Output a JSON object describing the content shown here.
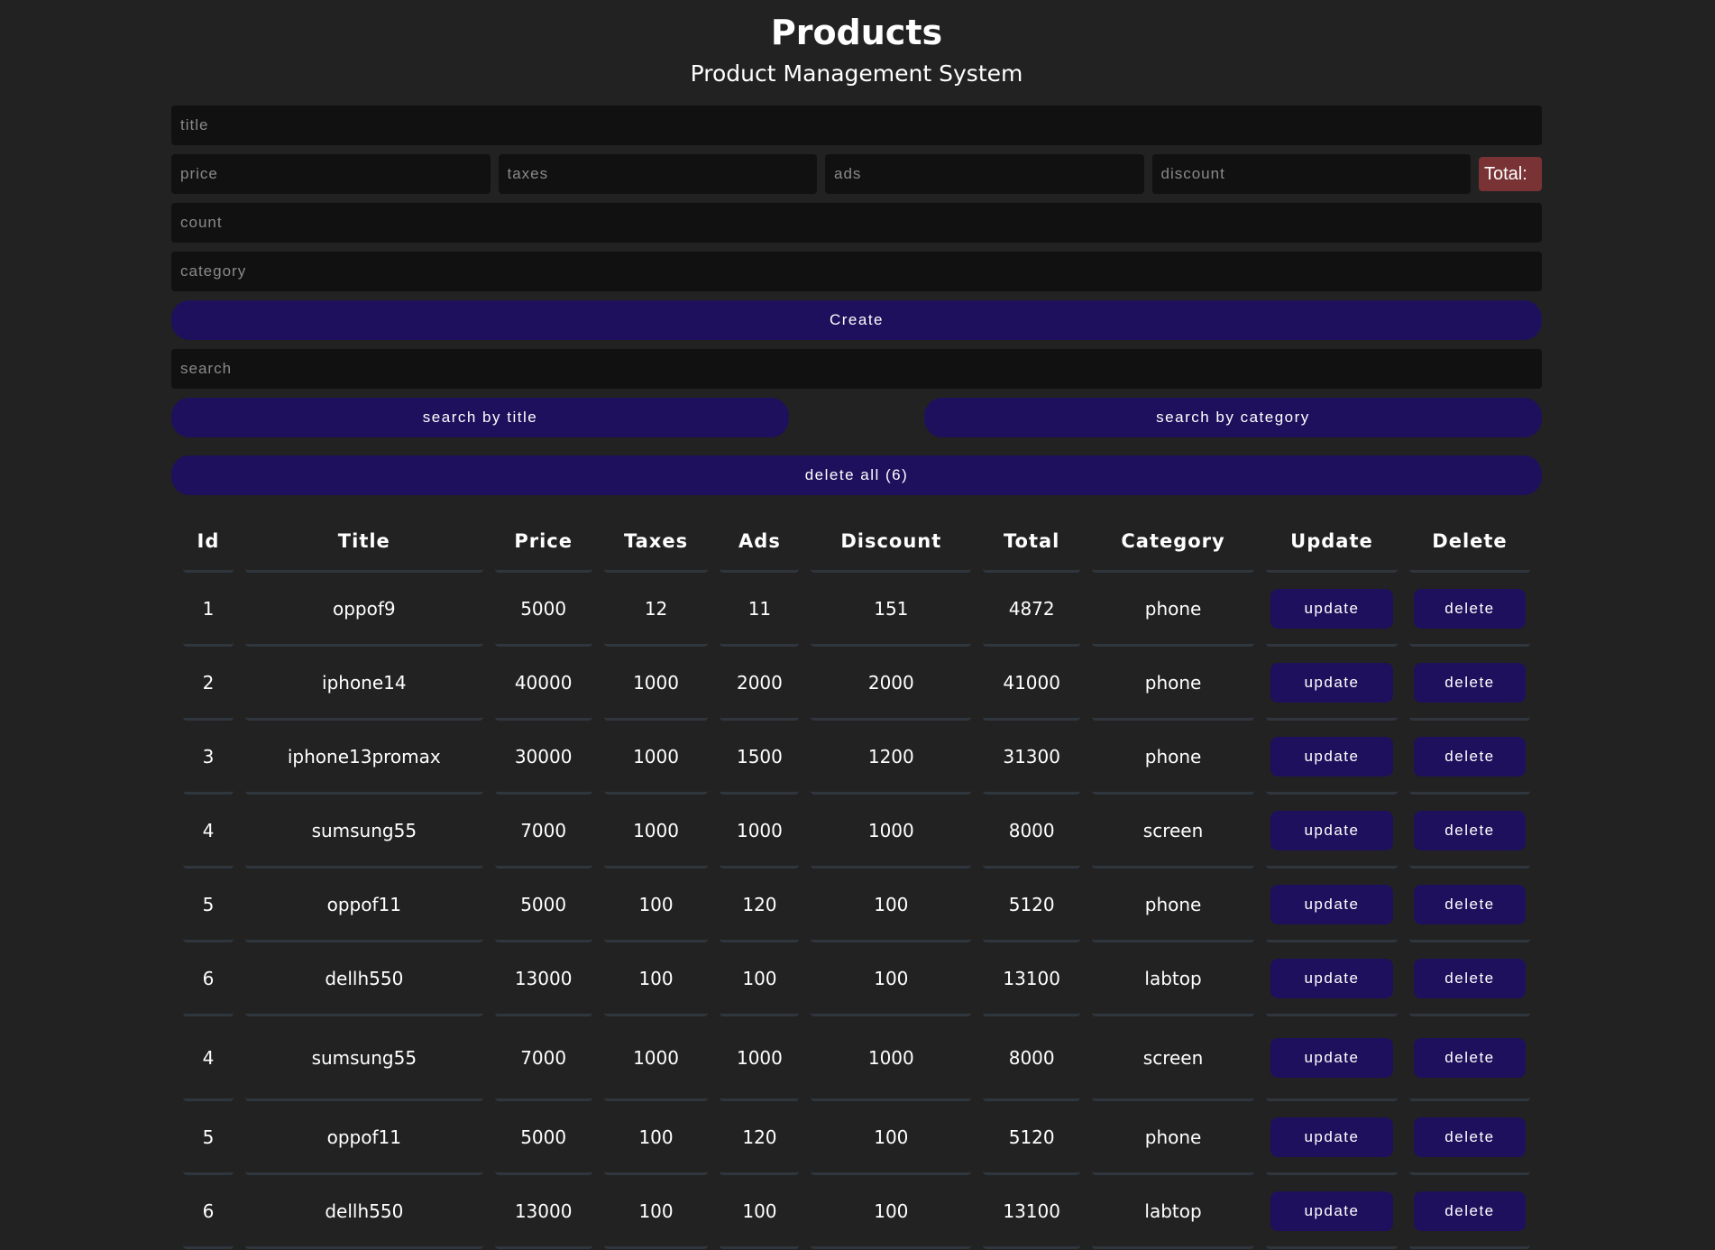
{
  "header": {
    "title": "Products",
    "subtitle": "Product Management System"
  },
  "form": {
    "title_placeholder": "title",
    "price_placeholder": "price",
    "taxes_placeholder": "taxes",
    "ads_placeholder": "ads",
    "discount_placeholder": "discount",
    "total_label": "Total:",
    "total_bg": "#7a3335",
    "count_placeholder": "count",
    "category_placeholder": "category",
    "create_label": "Create"
  },
  "search": {
    "placeholder": "search",
    "by_title_label": "search by title",
    "by_category_label": "search by category"
  },
  "delete_all_label": "delete all (6)",
  "colors": {
    "background": "#222222",
    "button": "#1f105d",
    "input": "#111111"
  },
  "table": {
    "headers": [
      "Id",
      "Title",
      "Price",
      "Taxes",
      "Ads",
      "Discount",
      "Total",
      "Category",
      "Update",
      "Delete"
    ],
    "update_label": "update",
    "delete_label": "delete",
    "rows": [
      {
        "id": "1",
        "title": "oppof9",
        "price": "5000",
        "taxes": "12",
        "ads": "11",
        "discount": "151",
        "total": "4872",
        "category": "phone"
      },
      {
        "id": "2",
        "title": "iphone14",
        "price": "40000",
        "taxes": "1000",
        "ads": "2000",
        "discount": "2000",
        "total": "41000",
        "category": "phone"
      },
      {
        "id": "3",
        "title": "iphone13promax",
        "price": "30000",
        "taxes": "1000",
        "ads": "1500",
        "discount": "1200",
        "total": "31300",
        "category": "phone"
      },
      {
        "id": "4",
        "title": "sumsung55",
        "price": "7000",
        "taxes": "1000",
        "ads": "1000",
        "discount": "1000",
        "total": "8000",
        "category": "screen"
      },
      {
        "id": "5",
        "title": "oppof11",
        "price": "5000",
        "taxes": "100",
        "ads": "120",
        "discount": "100",
        "total": "5120",
        "category": "phone"
      },
      {
        "id": "6",
        "title": "dellh550",
        "price": "13000",
        "taxes": "100",
        "ads": "100",
        "discount": "100",
        "total": "13100",
        "category": "labtop"
      },
      {
        "id": "4",
        "title": "sumsung55",
        "price": "7000",
        "taxes": "1000",
        "ads": "1000",
        "discount": "1000",
        "total": "8000",
        "category": "screen"
      },
      {
        "id": "5",
        "title": "oppof11",
        "price": "5000",
        "taxes": "100",
        "ads": "120",
        "discount": "100",
        "total": "5120",
        "category": "phone"
      },
      {
        "id": "6",
        "title": "dellh550",
        "price": "13000",
        "taxes": "100",
        "ads": "100",
        "discount": "100",
        "total": "13100",
        "category": "labtop"
      }
    ]
  }
}
